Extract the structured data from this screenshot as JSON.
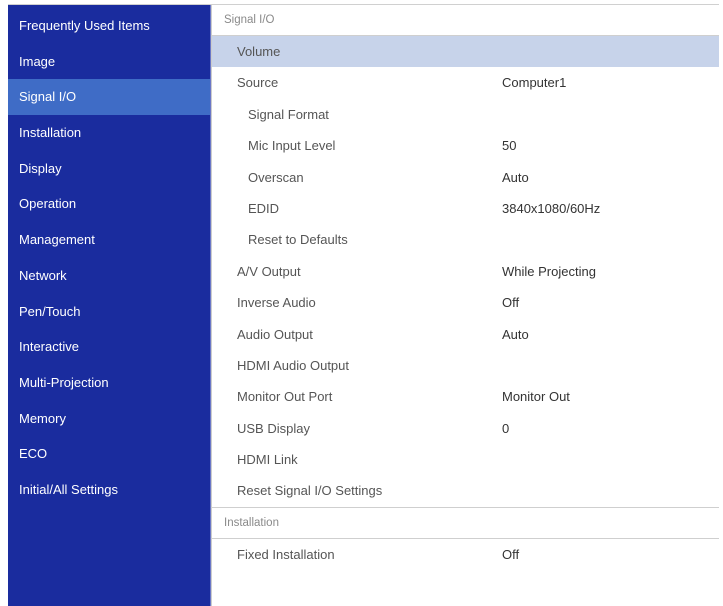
{
  "sidebar": {
    "items": [
      {
        "label": "Frequently Used Items"
      },
      {
        "label": "Image"
      },
      {
        "label": "Signal I/O",
        "selected": true
      },
      {
        "label": "Installation"
      },
      {
        "label": "Display"
      },
      {
        "label": "Operation"
      },
      {
        "label": "Management"
      },
      {
        "label": "Network"
      },
      {
        "label": "Pen/Touch"
      },
      {
        "label": "Interactive"
      },
      {
        "label": "Multi-Projection"
      },
      {
        "label": "Memory"
      },
      {
        "label": "ECO"
      },
      {
        "label": "Initial/All Settings"
      }
    ]
  },
  "main": {
    "section1": {
      "title": "Signal I/O",
      "rows": [
        {
          "label": "Volume",
          "value": ""
        },
        {
          "label": "Source",
          "value": "Computer1"
        },
        {
          "label": "Signal Format",
          "value": ""
        },
        {
          "label": "Mic Input Level",
          "value": "50"
        },
        {
          "label": "Overscan",
          "value": "Auto"
        },
        {
          "label": "EDID",
          "value": "3840x1080/60Hz"
        },
        {
          "label": "Reset to Defaults",
          "value": ""
        },
        {
          "label": "A/V Output",
          "value": "While Projecting"
        },
        {
          "label": "Inverse Audio",
          "value": "Off"
        },
        {
          "label": "Audio Output",
          "value": "Auto"
        },
        {
          "label": "HDMI Audio Output",
          "value": ""
        },
        {
          "label": "Monitor Out Port",
          "value": "Monitor Out"
        },
        {
          "label": "USB Display",
          "value": "0"
        },
        {
          "label": "HDMI Link",
          "value": ""
        },
        {
          "label": "Reset Signal I/O Settings",
          "value": ""
        }
      ]
    },
    "section2": {
      "title": "Installation",
      "rows": [
        {
          "label": "Fixed Installation",
          "value": "Off"
        }
      ]
    }
  },
  "colors": {
    "sidebar_bg": "#1a2c9e",
    "sidebar_selected": "#3f6cc6",
    "row_highlight": "#c7d3ea"
  }
}
